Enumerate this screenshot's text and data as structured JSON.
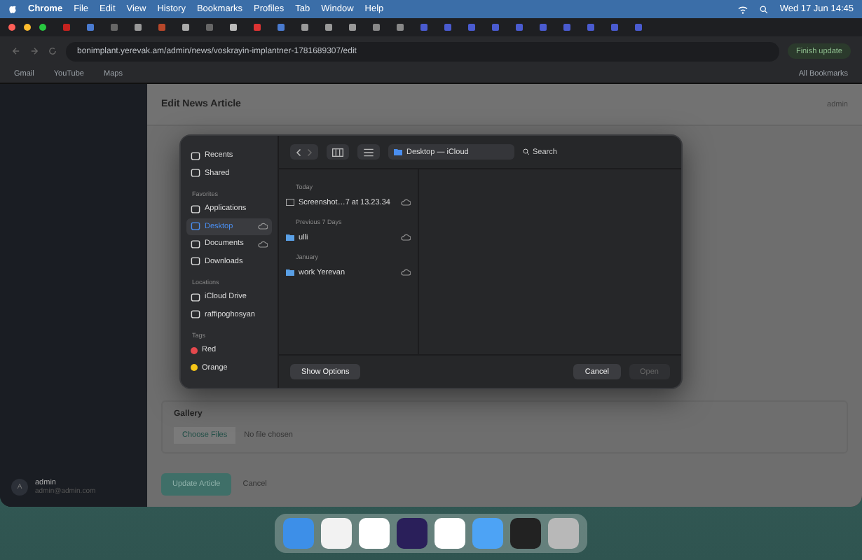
{
  "menu_bar": {
    "app": "Chrome",
    "items": [
      "File",
      "Edit",
      "View",
      "History",
      "Bookmarks",
      "Profiles",
      "Tab",
      "Window",
      "Help"
    ],
    "clock": "Wed 17 Jun  14:45"
  },
  "browser": {
    "address": "bonimplant.yerevak.am/admin/news/voskrayin-implantner-1781689307/edit",
    "update_button": "Finish update",
    "bookmarks": [
      "Gmail",
      "YouTube",
      "Maps"
    ],
    "all_bookmarks": "All Bookmarks"
  },
  "page": {
    "title": "Edit News Article",
    "user_menu": "admin",
    "gallery_label": "Gallery",
    "choose_files": "Choose Files",
    "no_file": "No file chosen",
    "submit": "Update Article",
    "cancel": "Cancel",
    "user": {
      "initial": "A",
      "name": "admin",
      "email": "admin@admin.com"
    }
  },
  "dialog": {
    "sidebar": [
      {
        "items": [
          {
            "label": "Recents",
            "selected": false,
            "cloud": false
          },
          {
            "label": "Shared",
            "selected": false,
            "cloud": false
          }
        ]
      },
      {
        "header": "Favorites",
        "items": [
          {
            "label": "Applications",
            "selected": false,
            "cloud": false
          },
          {
            "label": "Desktop",
            "selected": true,
            "cloud": true
          },
          {
            "label": "Documents",
            "selected": false,
            "cloud": true
          },
          {
            "label": "Downloads",
            "selected": false,
            "cloud": false
          }
        ]
      },
      {
        "header": "Locations",
        "items": [
          {
            "label": "iCloud Drive",
            "selected": false,
            "cloud": false
          },
          {
            "label": "raffipoghosyan",
            "selected": false,
            "cloud": false
          }
        ]
      },
      {
        "header": "Tags",
        "items": [
          {
            "label": "Red",
            "selected": false,
            "cloud": false,
            "color": "#e5484d"
          },
          {
            "label": "Orange",
            "selected": false,
            "cloud": false,
            "color": "#f5c518"
          }
        ]
      }
    ],
    "location": "Desktop — iCloud",
    "search": {
      "placeholder": "Search"
    },
    "groups": [
      {
        "header": "Today",
        "files": [
          {
            "kind": "file",
            "name": "Screenshot…7 at 13.23.34",
            "cloud": true
          }
        ]
      },
      {
        "header": "Previous 7 Days",
        "files": [
          {
            "kind": "folder",
            "name": "ulli",
            "cloud": true
          }
        ]
      },
      {
        "header": "January",
        "files": [
          {
            "kind": "folder",
            "name": "work Yerevan",
            "cloud": true
          }
        ]
      }
    ],
    "show_options": "Show Options",
    "cancel": "Cancel",
    "open": {
      "label": "Open",
      "disabled": true
    }
  }
}
